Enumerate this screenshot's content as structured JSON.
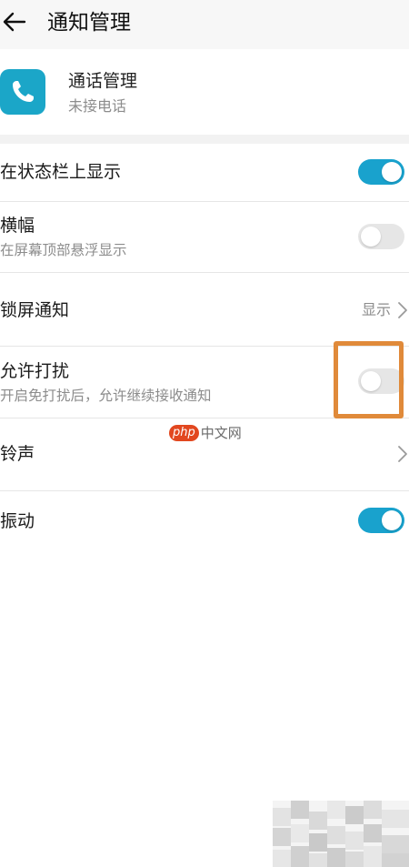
{
  "header": {
    "title": "通知管理",
    "back_icon": "arrow-left-icon"
  },
  "app": {
    "name": "通话管理",
    "subtitle": "未接电话",
    "icon": "phone-icon",
    "icon_color": "#1ba6c8"
  },
  "settings": {
    "status_bar": {
      "label": "在状态栏上显示",
      "enabled": true
    },
    "banner": {
      "label": "横幅",
      "sub": "在屏幕顶部悬浮显示",
      "enabled": false
    },
    "lock_screen": {
      "label": "锁屏通知",
      "value": "显示"
    },
    "dnd": {
      "label": "允许打扰",
      "sub": "开启免打扰后，允许继续接收通知",
      "enabled": false
    },
    "ringtone": {
      "label": "铃声"
    },
    "vibrate": {
      "label": "振动",
      "enabled": true
    }
  },
  "watermark": {
    "badge": "php",
    "text": "中文网"
  },
  "colors": {
    "toggle_on": "#19a2cd",
    "toggle_off": "#e6e6e6",
    "highlight_border": "#e08a3a"
  }
}
